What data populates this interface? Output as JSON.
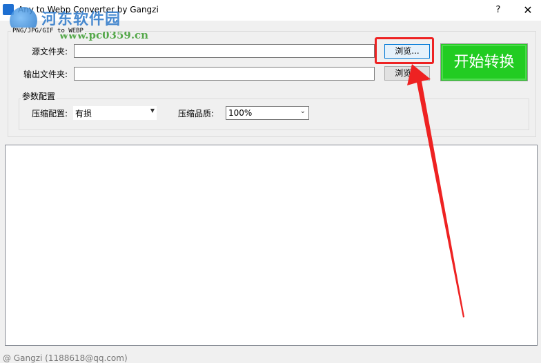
{
  "window": {
    "title": "Any to Webp Converter by Gangzi",
    "help_label": "?",
    "close_label": "✕",
    "icon": "app-icon"
  },
  "watermark": {
    "text_cn": "河东软件园",
    "url": "www.pc0359.cn"
  },
  "main_group": {
    "legend": "PNG/JPG/GIF to WEBP",
    "source_label": "源文件夹:",
    "source_value": "",
    "output_label": "输出文件夹:",
    "output_value": "",
    "browse_source_label": "浏览...",
    "browse_output_label": "浏览..."
  },
  "start_button": {
    "label": "开始转换",
    "color": "#22cc22"
  },
  "params": {
    "legend": "参数配置",
    "compress_mode_label": "压缩配置:",
    "compress_mode_value": "有损",
    "quality_label": "压缩品质:",
    "quality_value": "100%"
  },
  "log": {
    "content": ""
  },
  "status": {
    "text": "@ Gangzi (1188618@qq.com)"
  },
  "annotation": {
    "highlight_color": "#ee2222"
  }
}
